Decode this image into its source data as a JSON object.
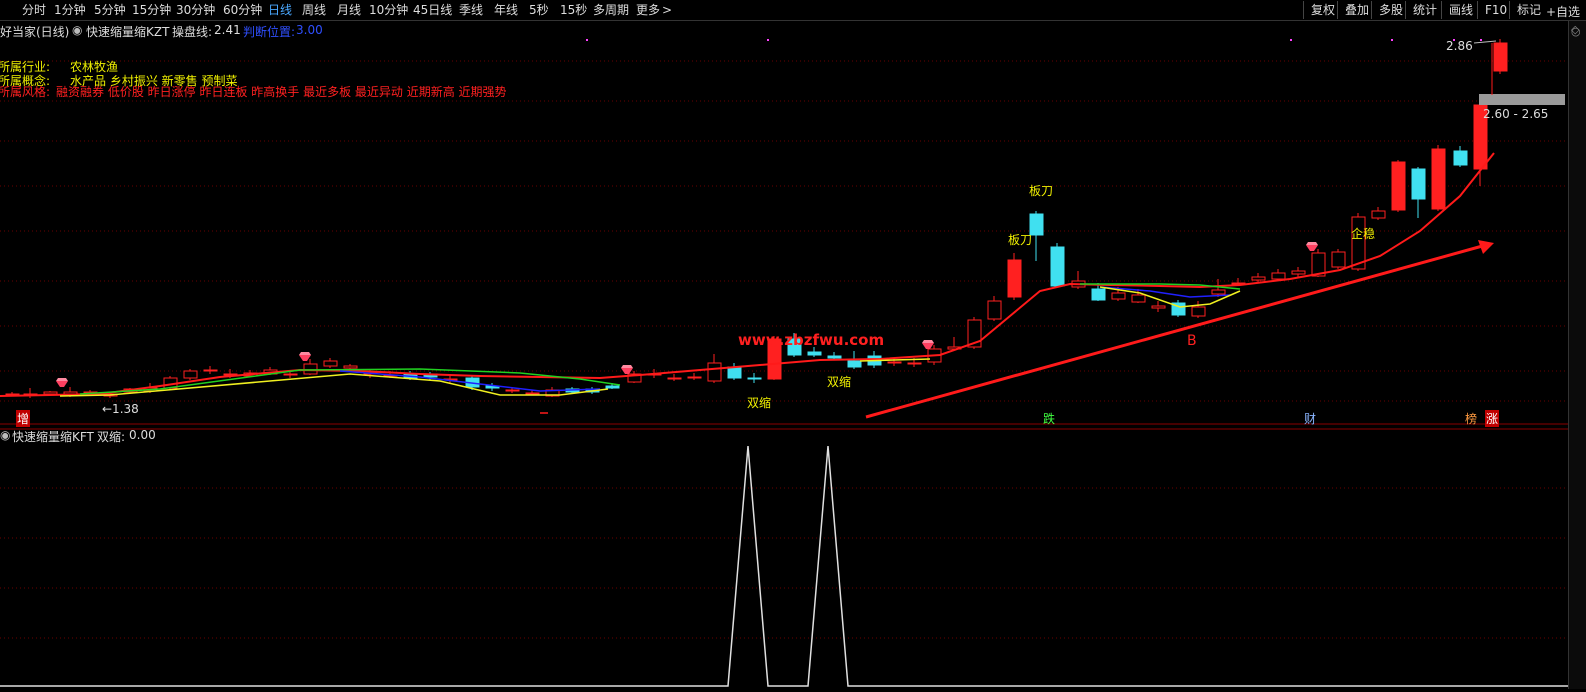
{
  "toolbar": {
    "periods": [
      "分时",
      "1分钟",
      "5分钟",
      "15分钟",
      "30分钟",
      "60分钟",
      "日线",
      "周线",
      "月线",
      "10分钟",
      "45日线",
      "季线",
      "年线",
      "5秒",
      "15秒",
      "多周期",
      "更多"
    ],
    "active_period": "日线",
    "more_arrow": ">",
    "tools": [
      "复权",
      "叠加",
      "多股",
      "统计",
      "画线",
      "F10",
      "标记"
    ],
    "overflow": "+自选"
  },
  "main": {
    "stock_name": "好当家(日线)",
    "indicator_name": "快速缩量缩KZT",
    "control_line_label": "操盘线:",
    "control_line_value": "2.41",
    "judge_label": "判断位置:",
    "judge_value": "3.00",
    "industry_label": "所属行业:",
    "industry": "农林牧渔",
    "concept_label": "所属概念:",
    "concepts": "水产品 乡村振兴 新零售 预制菜",
    "style_label": "所属风格:",
    "styles": "融资融券 低价股 昨日涨停 昨日连板 昨高换手 最近多板 最近异动 近期新高 近期强势",
    "watermark": "www.zbzfwu.com",
    "price_high": "2.86",
    "price_range": "2.60 - 2.65",
    "price_low": "←1.38",
    "signals": {
      "shuangsuo": "双缩",
      "bandao": "板刀",
      "qiwen": "企稳",
      "b": "B"
    },
    "bottom_tags": [
      "增",
      "跌",
      "财",
      "榜",
      "涨"
    ]
  },
  "indicator": {
    "name": "快速缩量缩KFT",
    "value_label": "双缩:",
    "value": "0.00"
  },
  "colors": {
    "up": "#ff2020",
    "down": "#40e0f0",
    "ma": "#ff1a1a",
    "blue": "#2020ff",
    "green": "#20d020",
    "yellow": "#f0f020",
    "text_yellow": "#f0f000",
    "text_red": "#ff2020"
  }
}
